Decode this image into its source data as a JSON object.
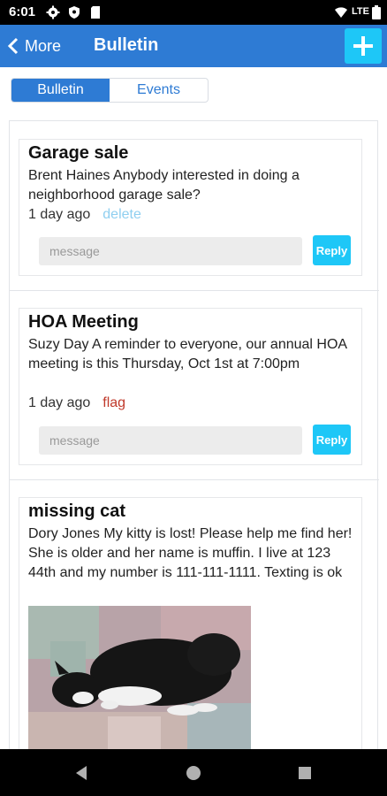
{
  "status_bar": {
    "time": "6:01",
    "network": "LTE"
  },
  "app_bar": {
    "back_label": "More",
    "title": "Bulletin",
    "add_icon": "plus-icon"
  },
  "tabs": [
    {
      "label": "Bulletin",
      "active": true
    },
    {
      "label": "Events",
      "active": false
    }
  ],
  "posts": [
    {
      "title": "Garage sale",
      "body": "Brent Haines Anybody interested in doing a neighborhood garage sale?",
      "age": "1 day ago",
      "action": "delete",
      "message_placeholder": "message",
      "reply_label": "Reply"
    },
    {
      "title": "HOA Meeting",
      "body": "Suzy Day A reminder to everyone, our annual HOA meeting is this Thursday, Oct 1st at 7:00pm",
      "age": "1 day ago",
      "action": "flag",
      "message_placeholder": "message",
      "reply_label": "Reply"
    },
    {
      "title": "missing cat",
      "body": "Dory Jones My kitty is lost! Please help me find her! She is older and her name is muffin. I live at 123 44th and my number is 111-111-1111. Texting is ok"
    }
  ],
  "colors": {
    "accent": "#2e7bd4",
    "button": "#1ec7f7",
    "delete": "#8fcff0",
    "flag": "#c0392b"
  }
}
